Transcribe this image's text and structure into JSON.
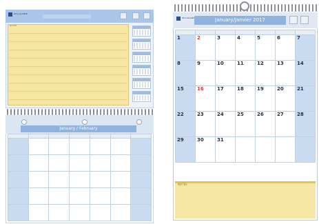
{
  "left_product": {
    "brand": "AT-A-GLANCE",
    "notes_label": "NOTES",
    "bottom_title": "January / February",
    "bottom_week_rows": [
      [
        "",
        "",
        "",
        "",
        "",
        "",
        ""
      ],
      [
        "",
        "",
        "",
        "",
        "",
        "",
        ""
      ],
      [
        "",
        "",
        "",
        "",
        "",
        "",
        ""
      ],
      [
        "",
        "",
        "",
        "",
        "",
        "",
        ""
      ],
      [
        "",
        "",
        "",
        "",
        "",
        "",
        ""
      ]
    ]
  },
  "right_product": {
    "brand": "AT-A-GLANCE",
    "title": "January/Janvier 2017",
    "notes_label": "NOTES",
    "weeks": [
      [
        "1",
        "2",
        "3",
        "4",
        "5",
        "6",
        "7"
      ],
      [
        "8",
        "9",
        "10",
        "11",
        "12",
        "13",
        "14"
      ],
      [
        "15",
        "16",
        "17",
        "18",
        "19",
        "20",
        "21"
      ],
      [
        "22",
        "23",
        "24",
        "25",
        "26",
        "27",
        "28"
      ],
      [
        "29",
        "30",
        "31",
        "",
        "",
        "",
        ""
      ]
    ],
    "red_days": [
      "2",
      "16"
    ]
  }
}
